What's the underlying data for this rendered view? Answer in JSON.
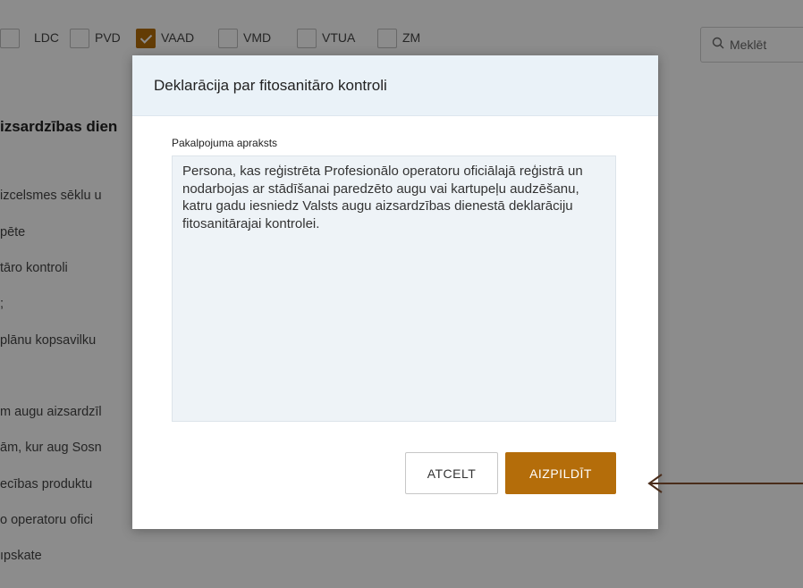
{
  "filters": [
    {
      "label": "LDC",
      "checked": false
    },
    {
      "label": "PVD",
      "checked": false
    },
    {
      "label": "VAAD",
      "checked": true
    },
    {
      "label": "VMD",
      "checked": false
    },
    {
      "label": "VTUA",
      "checked": false
    },
    {
      "label": "ZM",
      "checked": false
    }
  ],
  "search": {
    "placeholder": "Meklēt"
  },
  "list": {
    "title": "izsardzības dien",
    "items": [
      "izcelsmes sēklu u",
      "pēte",
      "tāro kontroli",
      ";",
      "plānu kopsavilku",
      "m augu aizsardzīl",
      "ām, kur aug Sosn",
      "ecības produktu",
      "o operatoru ofici",
      "ıpskate"
    ]
  },
  "dialog": {
    "title": "Deklarācija par fitosanitāro kontroli",
    "field_label": "Pakalpojuma apraksts",
    "description": "Persona, kas reģistrēta Profesionālo operatoru oficiālajā reģistrā un nodarbojas ar stādīšanai paredzēto augu vai kartupeļu audzēšanu, katru gadu iesniedz Valsts augu aizsardzības dienestā deklarāciju fitosanitārajai kontrolei.",
    "cancel_label": "ATCELT",
    "fill_label": "AIZPILDĪT"
  },
  "colors": {
    "accent": "#b46d0a",
    "header_bg": "#eaf2f8",
    "arrow": "#4a2c1a"
  }
}
